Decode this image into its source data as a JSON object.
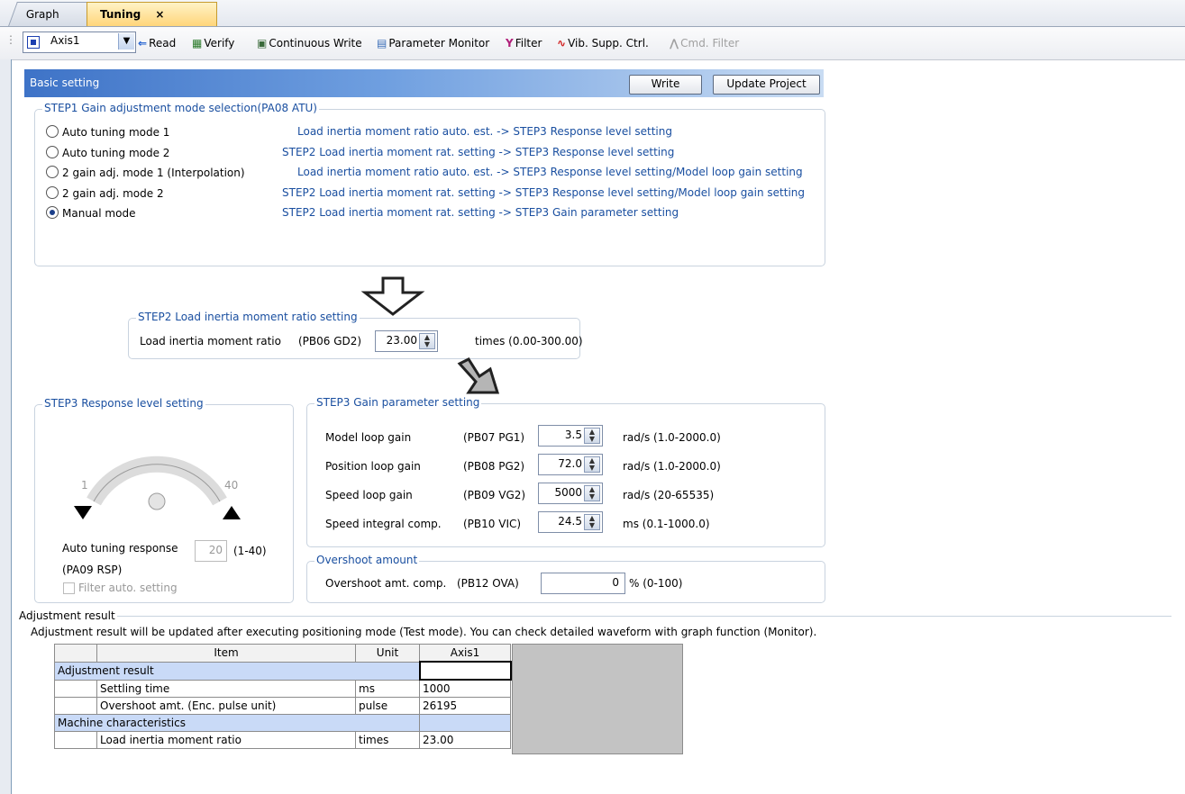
{
  "tabs": [
    {
      "label": "Graph"
    },
    {
      "label": "Tuning",
      "close": "×"
    }
  ],
  "toolbar": {
    "axis_select": "Axis1",
    "read": "Read",
    "verify": "Verify",
    "continuous_write": "Continuous Write",
    "parameter_monitor": "Parameter Monitor",
    "filter": "Filter",
    "vib_supp": "Vib. Supp. Ctrl.",
    "cmd_filter": "Cmd. Filter"
  },
  "basic_setting": {
    "title": "Basic setting",
    "write": "Write",
    "update_project": "Update Project"
  },
  "step1": {
    "title": "STEP1 Gain adjustment mode selection(PA08 ATU)",
    "modes": [
      {
        "label": "Auto tuning mode 1",
        "flow": "Load inertia moment ratio auto. est.  ->  STEP3 Response level setting",
        "selected": false
      },
      {
        "label": "Auto tuning mode 2",
        "flow": "STEP2 Load inertia moment rat. setting  ->  STEP3 Response level setting",
        "selected": false
      },
      {
        "label": "2 gain adj. mode 1 (Interpolation)",
        "flow": "Load inertia moment ratio auto. est.  ->  STEP3 Response level setting/Model loop gain setting",
        "selected": false
      },
      {
        "label": "2 gain adj. mode 2",
        "flow": "STEP2 Load inertia moment rat. setting  ->  STEP3 Response level setting/Model loop gain setting",
        "selected": false
      },
      {
        "label": "Manual mode",
        "flow": "STEP2 Load inertia moment rat. setting  ->  STEP3 Gain parameter setting",
        "selected": true
      }
    ]
  },
  "step2": {
    "title": "STEP2 Load inertia moment ratio setting",
    "label": "Load inertia moment ratio",
    "param": "(PB06 GD2)",
    "value": "23.00",
    "range": "times (0.00-300.00)"
  },
  "step3_response": {
    "title": "STEP3 Response level setting",
    "min": "1",
    "max": "40",
    "label1": "Auto tuning response",
    "label2": "(PA09 RSP)",
    "value": "20",
    "range": "(1-40)",
    "filter_auto": "Filter auto. setting"
  },
  "step3_gain": {
    "title": "STEP3 Gain parameter setting",
    "rows": [
      {
        "label": "Model loop gain",
        "param": "(PB07 PG1)",
        "value": "3.5",
        "range": "rad/s (1.0-2000.0)"
      },
      {
        "label": "Position loop gain",
        "param": "(PB08 PG2)",
        "value": "72.0",
        "range": "rad/s (1.0-2000.0)"
      },
      {
        "label": "Speed loop gain",
        "param": "(PB09 VG2)",
        "value": "5000",
        "range": "rad/s (20-65535)"
      },
      {
        "label": "Speed integral comp.",
        "param": "(PB10 VIC)",
        "value": "24.5",
        "range": "ms (0.1-1000.0)"
      }
    ]
  },
  "overshoot": {
    "title": "Overshoot amount",
    "label": "Overshoot amt. comp.",
    "param": "(PB12 OVA)",
    "value": "0",
    "range": "% (0-100)"
  },
  "adjustment": {
    "title": "Adjustment result",
    "note": "Adjustment result will be updated after executing positioning mode (Test mode). You can check detailed waveform with graph function (Monitor).",
    "headers": [
      "Item",
      "Unit",
      "Axis1"
    ],
    "sections": [
      {
        "name": "Adjustment result",
        "rows": [
          {
            "item": "Settling time",
            "unit": "ms",
            "value": "1000"
          },
          {
            "item": "Overshoot amt. (Enc. pulse unit)",
            "unit": "pulse",
            "value": "26195"
          }
        ]
      },
      {
        "name": "Machine characteristics",
        "rows": [
          {
            "item": "Load inertia moment ratio",
            "unit": "times",
            "value": "23.00"
          }
        ]
      }
    ]
  }
}
